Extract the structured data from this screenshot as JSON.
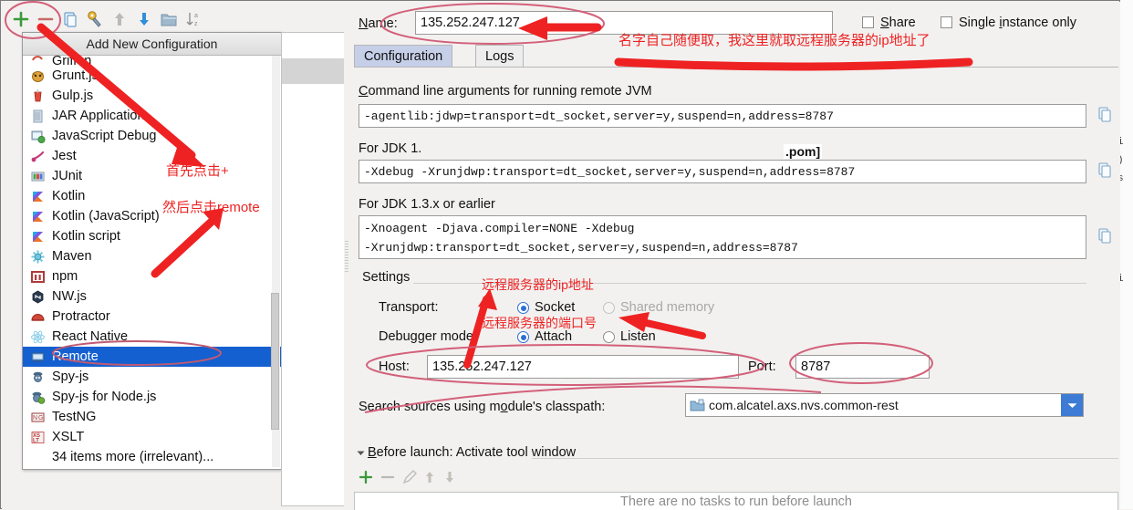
{
  "dialog": {
    "toolbar": {
      "icons": [
        {
          "name": "add-icon",
          "glyph": "+",
          "color": "#3a9a3a"
        },
        {
          "name": "remove-icon",
          "glyph": "−",
          "color": "#c86a6a"
        },
        {
          "name": "copy-icon",
          "glyph": "⧉",
          "color": "#7aa7d0"
        },
        {
          "name": "settings-icon",
          "glyph": "⚙",
          "color": "#d8a63a"
        },
        {
          "name": "move-up-icon",
          "glyph": "↑",
          "color": "#b5b5b5"
        },
        {
          "name": "move-down-icon",
          "glyph": "↓",
          "color": "#2f8fd8"
        },
        {
          "name": "folder-icon",
          "glyph": "▤",
          "color": "#9fb8cc"
        },
        {
          "name": "sort-icon",
          "glyph": "↓a",
          "color": "#8d8d8d"
        }
      ]
    },
    "popup": {
      "title": "Add New Configuration",
      "items": [
        {
          "label": "Griffon",
          "icon": "griffon-icon",
          "selected": false,
          "clipped": true
        },
        {
          "label": "Grunt.js",
          "icon": "grunt-icon",
          "selected": false
        },
        {
          "label": "Gulp.js",
          "icon": "gulp-icon",
          "selected": false
        },
        {
          "label": "JAR Application",
          "icon": "jar-icon",
          "selected": false
        },
        {
          "label": "JavaScript Debug",
          "icon": "javascript-debug-icon",
          "selected": false
        },
        {
          "label": "Jest",
          "icon": "jest-icon",
          "selected": false
        },
        {
          "label": "JUnit",
          "icon": "junit-icon",
          "selected": false
        },
        {
          "label": "Kotlin",
          "icon": "kotlin-icon",
          "selected": false
        },
        {
          "label": "Kotlin (JavaScript)",
          "icon": "kotlin-js-icon",
          "selected": false
        },
        {
          "label": "Kotlin script",
          "icon": "kotlin-script-icon",
          "selected": false
        },
        {
          "label": "Maven",
          "icon": "maven-icon",
          "selected": false
        },
        {
          "label": "npm",
          "icon": "npm-icon",
          "selected": false
        },
        {
          "label": "NW.js",
          "icon": "nwjs-icon",
          "selected": false
        },
        {
          "label": "Protractor",
          "icon": "protractor-icon",
          "selected": false
        },
        {
          "label": "React Native",
          "icon": "react-native-icon",
          "selected": false
        },
        {
          "label": "Remote",
          "icon": "remote-icon",
          "selected": true
        },
        {
          "label": "Spy-js",
          "icon": "spyjs-icon",
          "selected": false
        },
        {
          "label": "Spy-js for Node.js",
          "icon": "spyjs-node-icon",
          "selected": false
        },
        {
          "label": "TestNG",
          "icon": "testng-icon",
          "selected": false
        },
        {
          "label": "XSLT",
          "icon": "xslt-icon",
          "selected": false
        },
        {
          "label": "34 items more (irrelevant)...",
          "icon": "none",
          "selected": false
        }
      ]
    },
    "name_label": "Name:",
    "name_value": "135.252.247.127",
    "share_label": "Share",
    "share_checked": false,
    "single_instance_label": "Single instance only",
    "single_instance_checked": false,
    "tabs": [
      {
        "label": "Configuration",
        "active": true
      },
      {
        "label": "Logs",
        "active": false
      }
    ],
    "cmdline_label": "Command line arguments for running remote JVM",
    "cmdline_value": "-agentlib:jdwp=transport=dt_socket,server=y,suspend=n,address=8787",
    "jdk14_label": "For JDK 1.",
    "jdk14_overlay": ".pom]",
    "jdk14_value": "-Xdebug -Xrunjdwp:transport=dt_socket,server=y,suspend=n,address=8787",
    "jdk13_label": "For JDK 1.3.x or earlier",
    "jdk13_value_line1": "-Xnoagent -Djava.compiler=NONE -Xdebug",
    "jdk13_value_line2": "-Xrunjdwp:transport=dt_socket,server=y,suspend=n,address=8787",
    "settings_label": "Settings",
    "transport_label": "Transport:",
    "transport_options": [
      {
        "label": "Socket",
        "selected": true,
        "disabled": false
      },
      {
        "label": "Shared memory",
        "selected": false,
        "disabled": true
      }
    ],
    "debugger_mode_label": "Debugger mode:",
    "debugger_mode_options": [
      {
        "label": "Attach",
        "selected": true,
        "disabled": false
      },
      {
        "label": "Listen",
        "selected": false,
        "disabled": false
      }
    ],
    "host_label": "Host:",
    "host_value": "135.252.247.127",
    "port_label": "Port:",
    "port_value": "8787",
    "search_sources_label": "Search sources using module's classpath:",
    "search_sources_value": "com.alcatel.axs.nvs.common-rest",
    "before_launch_label": "Before launch: Activate tool window",
    "before_launch_empty": "There are no tasks to run before launch",
    "before_launch_toolbar": [
      {
        "name": "bl-add-icon",
        "glyph": "+",
        "color": "#3a9a3a"
      },
      {
        "name": "bl-remove-icon",
        "glyph": "−",
        "color": "#b9b9b9"
      },
      {
        "name": "bl-edit-icon",
        "glyph": "✎",
        "color": "#b9b9b9"
      },
      {
        "name": "bl-up-icon",
        "glyph": "↑",
        "color": "#c0bdb5"
      },
      {
        "name": "bl-down-icon",
        "glyph": "↓",
        "color": "#c0bdb5"
      }
    ]
  },
  "annotations": {
    "accent_color": "#ee2222",
    "notes": [
      {
        "name": "note-click-plus-first",
        "text": "首先点击+"
      },
      {
        "name": "note-then-click-remote",
        "text": "然后点击remote"
      },
      {
        "name": "note-name-anything",
        "text": "名字自己随便取，我这里就取远程服务器的ip地址了"
      },
      {
        "name": "note-remote-server-ip",
        "text": "远程服务器的ip地址"
      },
      {
        "name": "note-remote-server-port",
        "text": "远程服务器的端口号"
      }
    ]
  },
  "background_editor": {
    "fragments": [
      "i",
      ")",
      "s",
      "i"
    ]
  }
}
